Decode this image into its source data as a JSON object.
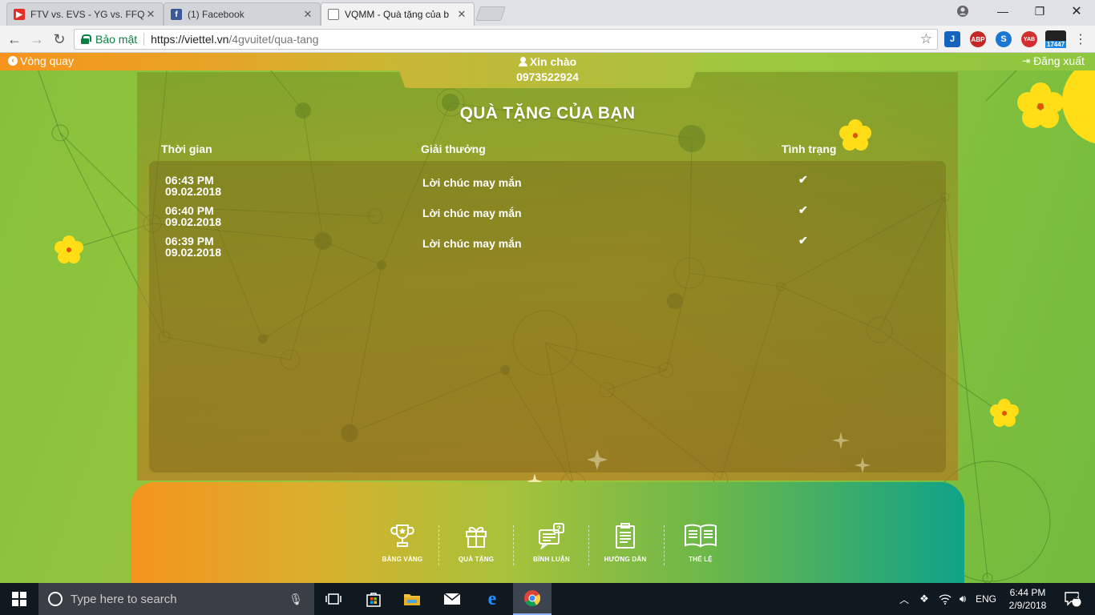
{
  "browser": {
    "tabs": [
      {
        "title": "FTV vs. EVS - YG vs. FFQ",
        "favicon": "youtube-icon"
      },
      {
        "title": "(1) Facebook",
        "favicon": "facebook-icon"
      },
      {
        "title": "VQMM - Quà tặng của b",
        "favicon": "document-icon"
      }
    ],
    "secure_label": "Bảo mật",
    "url_host": "https://viettel.vn",
    "url_path": "/4gvuitet/qua-tang",
    "extensions": [
      "J",
      "ABP",
      "S",
      "YAB",
      "17447"
    ]
  },
  "header": {
    "left_link": "Vòng quay",
    "greeting": "Xin chào",
    "phone": "0973522924",
    "right_link": "Đăng xuất"
  },
  "gifts": {
    "title": "QUÀ TẶNG CỦA BẠN",
    "columns": [
      "Thời gian",
      "Giải thưởng",
      "Tình trạng"
    ],
    "rows": [
      {
        "time": "06:43 PM",
        "date": "09.02.2018",
        "prize": "Lời chúc may mắn",
        "status": "✔"
      },
      {
        "time": "06:40 PM",
        "date": "09.02.2018",
        "prize": "Lời chúc may mắn",
        "status": "✔"
      },
      {
        "time": "06:39 PM",
        "date": "09.02.2018",
        "prize": "Lời chúc may mắn",
        "status": "✔"
      }
    ]
  },
  "bottom_nav": [
    {
      "label": "BẢNG VÀNG",
      "icon": "trophy-icon"
    },
    {
      "label": "QUÀ TẶNG",
      "icon": "gift-icon"
    },
    {
      "label": "BÌNH LUẬN",
      "icon": "comment-icon"
    },
    {
      "label": "HƯỚNG DẪN",
      "icon": "clipboard-icon"
    },
    {
      "label": "THỂ LỆ",
      "icon": "book-icon"
    }
  ],
  "taskbar": {
    "search_placeholder": "Type here to search",
    "language": "ENG",
    "time": "6:44 PM",
    "date": "2/9/2018",
    "notifications": "2"
  }
}
